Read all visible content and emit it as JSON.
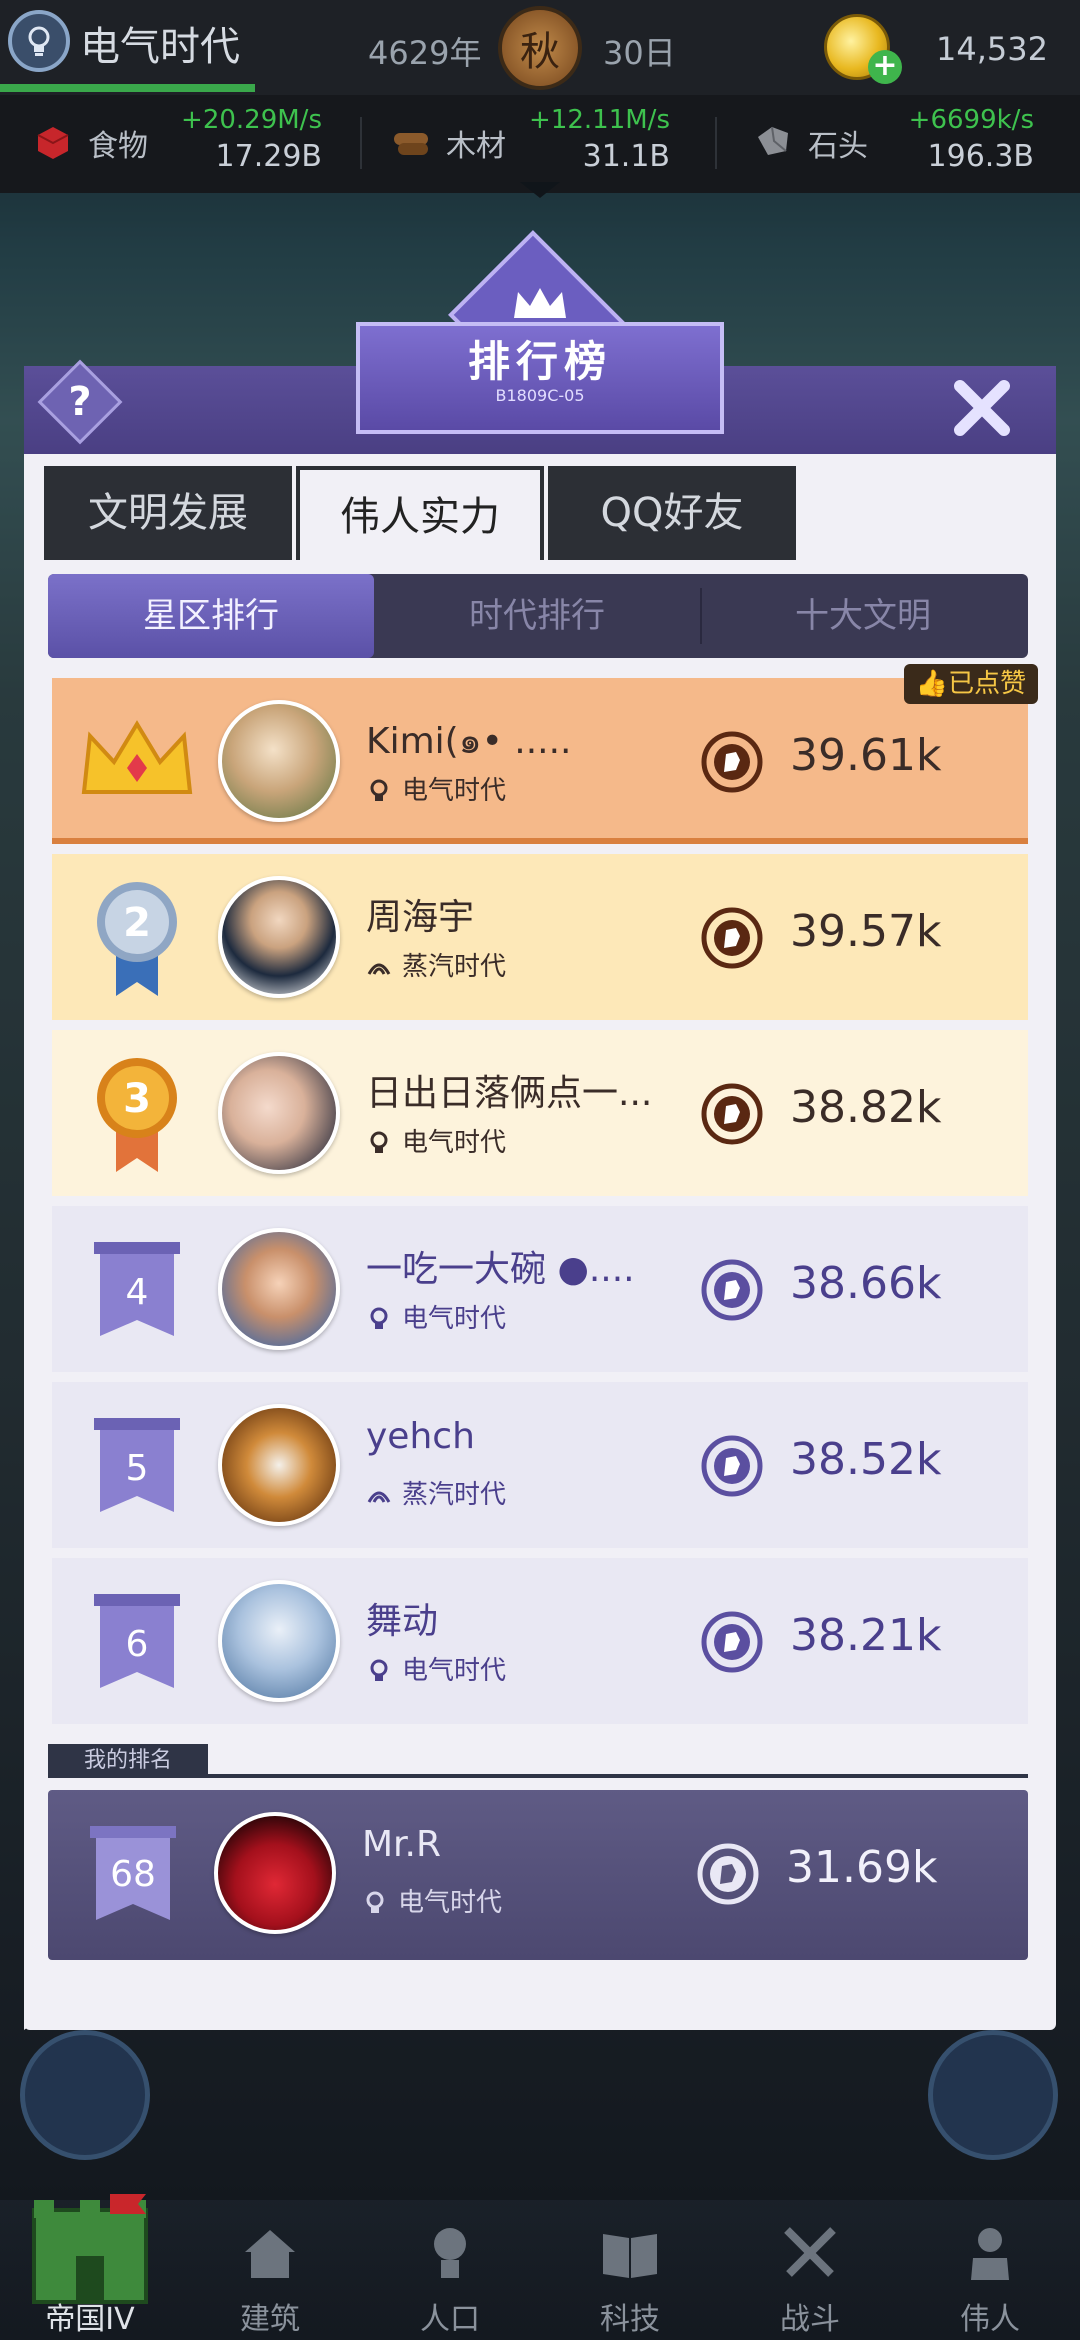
{
  "status": {
    "era_name": "电气时代",
    "year": "4629年",
    "season": "秋",
    "day": "30日",
    "coins": "14,532"
  },
  "resources": [
    {
      "name": "食物",
      "rate": "+20.29M/s",
      "total": "17.29B",
      "icon": "food-icon"
    },
    {
      "name": "木材",
      "rate": "+12.11M/s",
      "total": "31.1B",
      "icon": "wood-icon"
    },
    {
      "name": "石头",
      "rate": "+6699k/s",
      "total": "196.3B",
      "icon": "stone-icon"
    }
  ],
  "modal": {
    "title": "排行榜",
    "subtitle": "B1809C-05",
    "tabs": [
      "文明发展",
      "伟人实力",
      "QQ好友"
    ],
    "active_tab": 1,
    "subtabs": [
      "星区排行",
      "时代排行",
      "十大文明"
    ],
    "active_subtab": 0,
    "liked_badge": "已点赞",
    "my_rank_label": "我的排名"
  },
  "ranking": [
    {
      "rank": "1",
      "name": "Kimi(๑• .....",
      "era": "电气时代",
      "power": "39.61k",
      "style": "gold"
    },
    {
      "rank": "2",
      "name": "周海宇",
      "era": "蒸汽时代",
      "power": "39.57k",
      "style": "silver"
    },
    {
      "rank": "3",
      "name": "日出日落俩点一...",
      "era": "电气时代",
      "power": "38.82k",
      "style": "bronze"
    },
    {
      "rank": "4",
      "name": "一吃一大碗 ●....",
      "era": "电气时代",
      "power": "38.66k",
      "style": "plain"
    },
    {
      "rank": "5",
      "name": "yehch",
      "era": "蒸汽时代",
      "power": "38.52k",
      "style": "plain"
    },
    {
      "rank": "6",
      "name": "舞动",
      "era": "电气时代",
      "power": "38.21k",
      "style": "plain"
    }
  ],
  "me": {
    "rank": "68",
    "name": "Mr.R",
    "era": "电气时代",
    "power": "31.69k"
  },
  "bottom_nav": [
    "帝国IV",
    "建筑",
    "人口",
    "科技",
    "战斗",
    "伟人"
  ],
  "colors": {
    "gold_row": "#f5b98a",
    "silver_row": "#fde8b8",
    "bronze_row": "#fdf3dc",
    "plain_row": "#e9e8f3",
    "accent_purple": "#5b51a7",
    "power_icon_brown": "#5a2812",
    "power_icon_purple": "#5b4fa0"
  }
}
